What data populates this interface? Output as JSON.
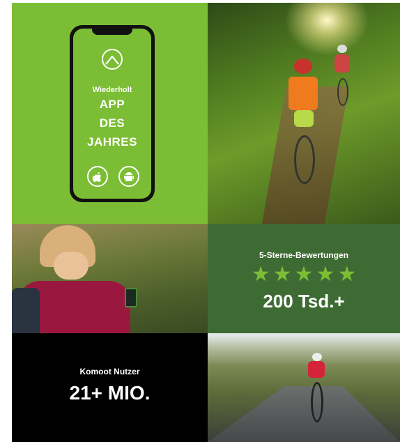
{
  "app_tile": {
    "award_prefix": "Wiederholt",
    "award_line1": "APP",
    "award_line2": "DES",
    "award_line3": "JAHRES",
    "logo_icon": "komoot-logo-icon",
    "store_icons": [
      "apple-icon",
      "android-icon"
    ],
    "bg_color": "#7bbd34"
  },
  "rating_tile": {
    "label": "5-Sterne-Bewertungen",
    "stars": 5,
    "value": "200 Tsd.+",
    "bg_color": "#3e6b33",
    "star_color": "#7bbd34"
  },
  "users_tile": {
    "label": "Komoot Nutzer",
    "value": "21+ MIO.",
    "bg_color": "#000000"
  }
}
